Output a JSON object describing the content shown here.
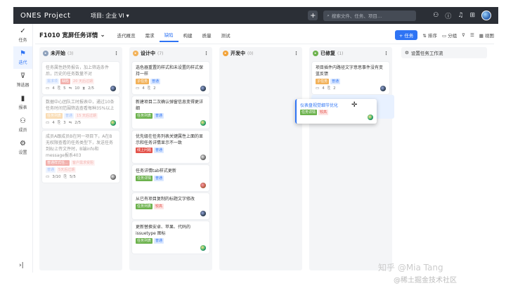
{
  "topbar": {
    "logo": "ONES Project",
    "project": "项目: 企业 VI",
    "search_placeholder": "搜索文件、任务、项目…"
  },
  "sidebar": [
    {
      "label": "任务",
      "icon": "check-circle-icon",
      "name": "tasks"
    },
    {
      "label": "迭代",
      "icon": "flag-icon",
      "name": "iteration"
    },
    {
      "label": "筛选器",
      "icon": "filter-icon",
      "name": "filter"
    },
    {
      "label": "报表",
      "icon": "chart-icon",
      "name": "report"
    },
    {
      "label": "成员",
      "icon": "members-icon",
      "name": "members"
    },
    {
      "label": "设置",
      "icon": "gear-icon",
      "name": "settings"
    }
  ],
  "header": {
    "title": "F1010 宽屏任务详情",
    "tabs": [
      "迭代概览",
      "需求",
      "缺陷",
      "构建",
      "质量",
      "测试"
    ],
    "active_tab": "缺陷",
    "add_label": "+ 任务",
    "sort_label": "排序",
    "group_label": "分组",
    "view_label": "视图"
  },
  "columns": [
    {
      "name": "未开始",
      "count": "(3)",
      "color": "#8da0bb",
      "cards": [
        {
          "title": "任务属性趋势报告，加上筛选条件后，历史的任务数量不对",
          "tags": [
            {
              "text": "需求项",
              "c": "blue"
            },
            {
              "text": "缺陷",
              "c": "red"
            },
            {
              "text": "20 天后过期",
              "c": "pink"
            }
          ],
          "meta": [
            "4",
            "5",
            "10",
            "2/5"
          ],
          "faded": true
        },
        {
          "title": "数据中心团队工时报表中，通过10条任务时间范围筛选查看每种35%以上",
          "tags": [
            {
              "text": "任务列表",
              "c": "orange"
            },
            {
              "text": "普通",
              "c": "blue"
            },
            {
              "text": "15 天后过期",
              "c": "pink"
            }
          ],
          "meta": [
            "4",
            "3",
            "2/5"
          ],
          "faded": true
        },
        {
          "title": "成员A跟成员B在同一项目下，A在B无权限查看的任务类型下，发送任务到B/上传文件时，B端info和message报系403",
          "tags": [
            {
              "text": "普通样式任…",
              "c": "red"
            },
            {
              "text": "客户需求受阻",
              "c": "pink"
            }
          ],
          "tags2": [
            {
              "text": "普通",
              "c": "blue"
            },
            {
              "text": "5天后过期",
              "c": "pink"
            }
          ],
          "meta": [
            "3/10",
            "5/5"
          ],
          "faded": true
        }
      ]
    },
    {
      "name": "设计中",
      "count": "(7)",
      "color": "#f2b25a",
      "cards": [
        {
          "title": "选色器重置的样式和未设置的样式保持一样",
          "tags": [
            {
              "text": "子任务",
              "c": "orange"
            },
            {
              "text": "普通",
              "c": "blue"
            }
          ],
          "meta": [
            "4",
            "2"
          ]
        },
        {
          "title": "新建项目二次确认弹窗信息变得更详细",
          "tags": [
            {
              "text": "任务列表",
              "c": "green"
            },
            {
              "text": "普通",
              "c": "blue"
            }
          ],
          "meta": []
        },
        {
          "title": "优先级在任务列表关键属性上面的显示和任务详情显示不一致",
          "tags": [
            {
              "text": "线上问题",
              "c": "red"
            },
            {
              "text": "普通",
              "c": "blue"
            }
          ],
          "meta": []
        },
        {
          "title": "任务详情tab样式更新",
          "tags": [
            {
              "text": "任务详情",
              "c": "green"
            },
            {
              "text": "普通",
              "c": "blue"
            }
          ],
          "meta": []
        },
        {
          "title": "从已有项目复制的标题文字修改",
          "tags": [
            {
              "text": "任务列表",
              "c": "green"
            },
            {
              "text": "较高",
              "c": "pink"
            }
          ],
          "meta": []
        },
        {
          "title": "更新替换安卓、苹果、代码的issuetype 图标",
          "tags": [
            {
              "text": "任务列表",
              "c": "green"
            },
            {
              "text": "普通",
              "c": "blue"
            }
          ],
          "meta": []
        }
      ]
    },
    {
      "name": "开发中",
      "count": "(0)",
      "color": "#f2a33a",
      "cards": []
    },
    {
      "name": "已修复",
      "count": "(1)",
      "color": "#6cb24d",
      "cards": [
        {
          "title": "项目插件内路径文字意思事件没有变蓝反馈",
          "tags": [
            {
              "text": "子任务",
              "c": "orange"
            },
            {
              "text": "普通",
              "c": "blue"
            }
          ],
          "meta": [
            "4",
            "2"
          ]
        }
      ]
    }
  ],
  "drag_card": {
    "title": "仪表盘视觉细节优化",
    "tags": [
      {
        "text": "任务详情",
        "c": "green"
      },
      {
        "text": "较高",
        "c": "pink"
      }
    ]
  },
  "flow_label": "设置任务工作流",
  "watermark": {
    "line1": "知乎 @Mia Tang",
    "line2": "@稀土掘金技术社区"
  }
}
